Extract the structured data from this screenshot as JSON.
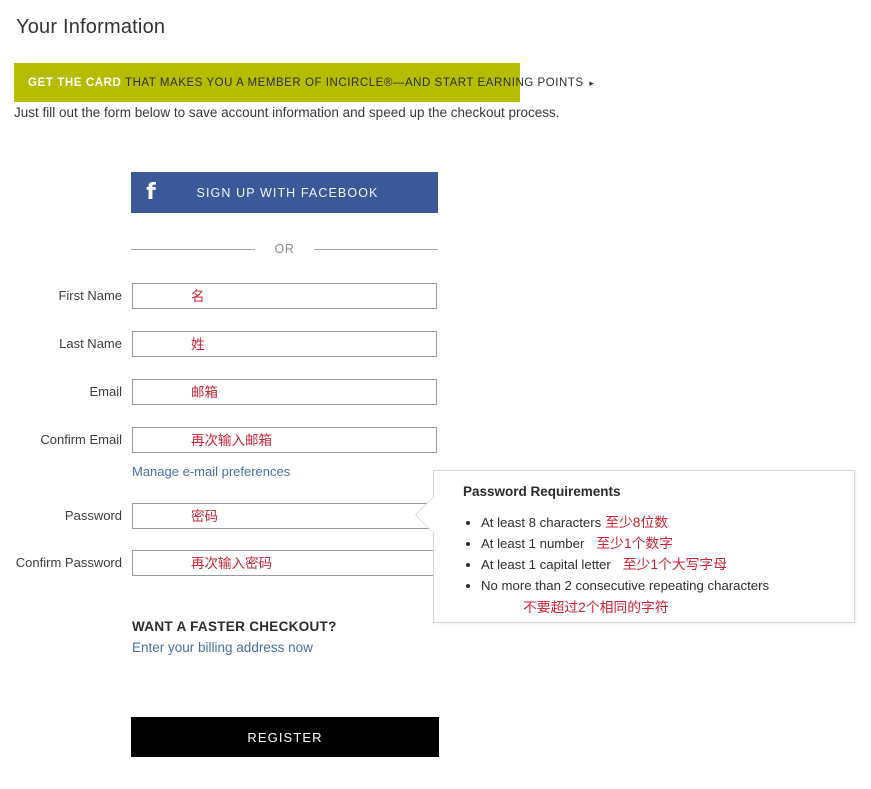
{
  "header": {
    "title": "Your Information",
    "intro": "Just fill out the form below to save account information and speed up the checkout process."
  },
  "promo": {
    "strong": "GET THE CARD",
    "rest": "THAT MAKES YOU A MEMBER OF INCIRCLE®—AND START EARNING POINTS",
    "arrow": "▸",
    "background_color": "#b4bd00"
  },
  "social": {
    "facebook_icon": "facebook-f-icon",
    "facebook_label": "SIGN UP WITH FACEBOOK",
    "facebook_color": "#3b5998"
  },
  "divider": {
    "label": "OR"
  },
  "form": {
    "fields": [
      {
        "label": "First Name",
        "placeholder": "名",
        "type": "text"
      },
      {
        "label": "Last Name",
        "placeholder": "姓",
        "type": "text"
      },
      {
        "label": "Email",
        "placeholder": "邮箱",
        "type": "text"
      },
      {
        "label": "Confirm Email",
        "placeholder": "再次输入邮箱",
        "type": "text"
      },
      {
        "label": "Password",
        "placeholder": "密码",
        "type": "text"
      },
      {
        "label": "Confirm Password",
        "placeholder": "再次输入密码",
        "type": "text"
      }
    ],
    "manage_email_link": "Manage e-mail preferences",
    "placeholder_color": "#cc2233"
  },
  "password_tooltip": {
    "title": "Password Requirements",
    "items": [
      {
        "en": "At least 8 characters",
        "cn": "至少8位数"
      },
      {
        "en": "At least 1 number",
        "cn": "至少1个数字"
      },
      {
        "en": "At least 1 capital letter",
        "cn": "至少1个大写字母"
      },
      {
        "en": "No more than 2 consecutive repeating characters",
        "cn": "不要超过2个相同的字符"
      }
    ]
  },
  "faster_checkout": {
    "title": "WANT A FASTER CHECKOUT?",
    "link": "Enter your billing address now"
  },
  "submit": {
    "label": "REGISTER",
    "background_color": "#000000"
  }
}
